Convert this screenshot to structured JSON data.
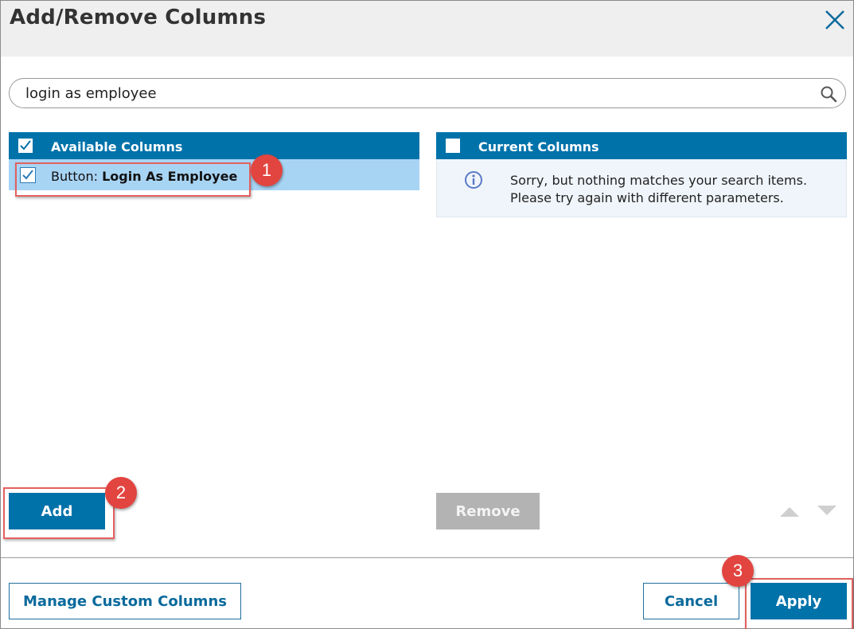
{
  "dialog": {
    "title": "Add/Remove Columns",
    "close_icon": "close-icon"
  },
  "search": {
    "value": "login as employee",
    "icon": "search-icon"
  },
  "available": {
    "header": "Available Columns",
    "header_checked": true,
    "items": [
      {
        "prefix": "Button: ",
        "name": "Login As Employee",
        "checked": true
      }
    ]
  },
  "current": {
    "header": "Current Columns",
    "header_checked": false,
    "empty_line1": "Sorry, but nothing matches your search items.",
    "empty_line2": "Please try again with different parameters.",
    "icon": "info-icon"
  },
  "buttons": {
    "add": "Add",
    "remove": "Remove",
    "manage": "Manage Custom Columns",
    "cancel": "Cancel",
    "apply": "Apply"
  },
  "badges": [
    "1",
    "2",
    "3"
  ],
  "colors": {
    "primary": "#0072aa",
    "selected_row": "#a8d4f4",
    "highlight": "#e2615f",
    "badge": "#e2443f",
    "disabled": "#b3b3b3"
  }
}
